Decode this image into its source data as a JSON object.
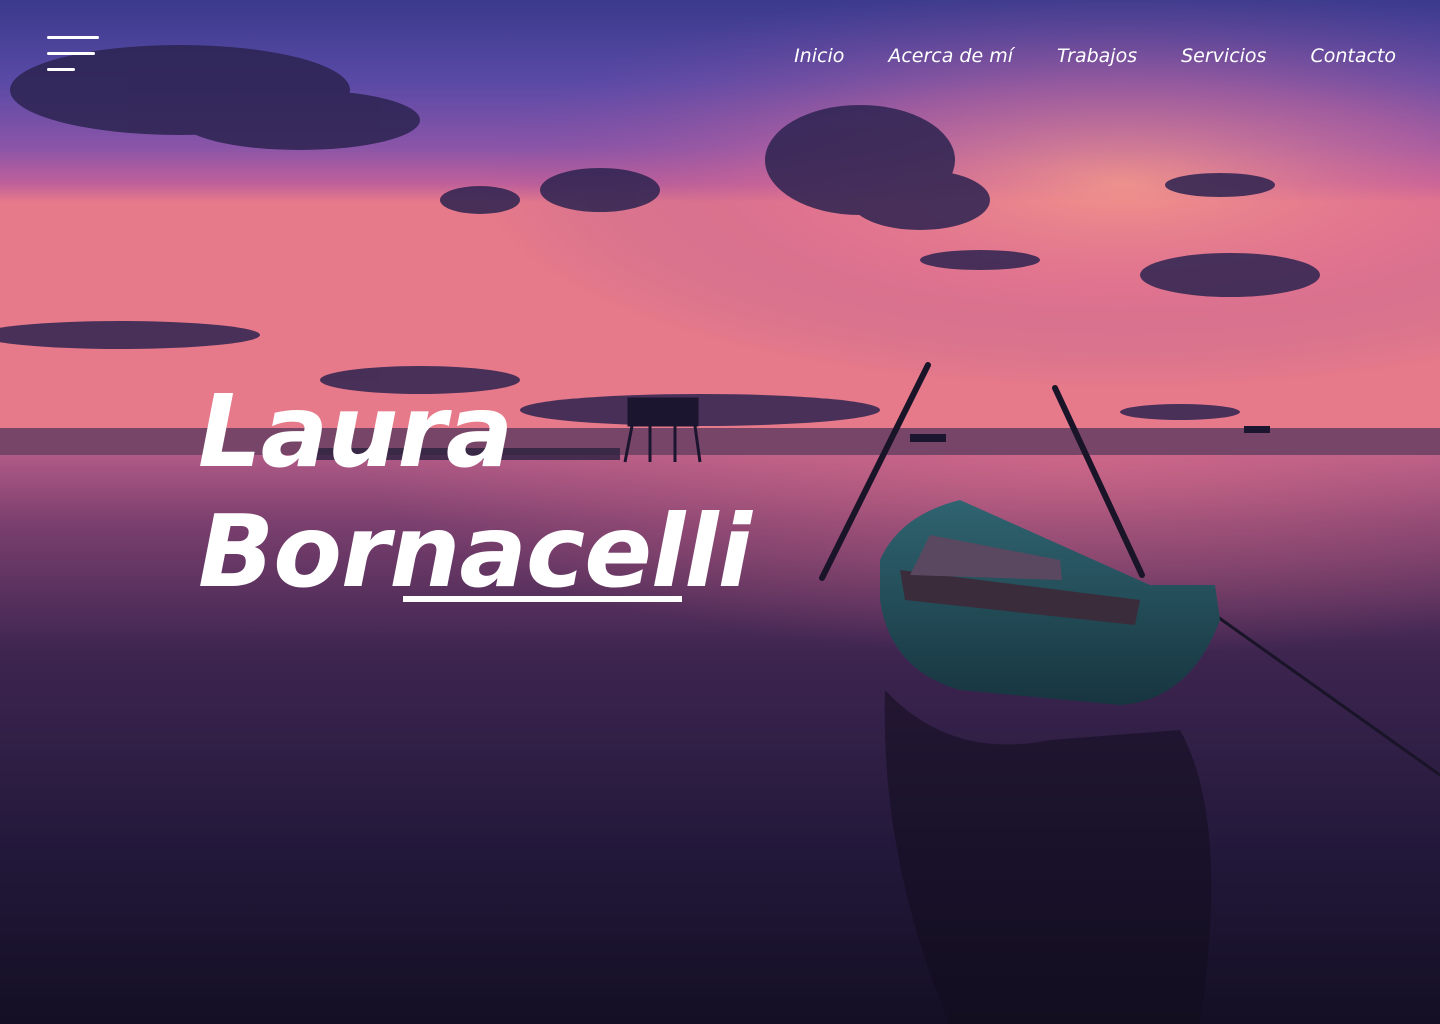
{
  "header": {
    "menu_icon": "hamburger-menu-icon",
    "nav": [
      {
        "label": "Inicio"
      },
      {
        "label": "Acerca de mí"
      },
      {
        "label": "Trabajos"
      },
      {
        "label": "Servicios"
      },
      {
        "label": "Contacto"
      }
    ]
  },
  "hero": {
    "first_name": "Laura",
    "last_name": "Bornacelli",
    "text_color": "#ffffff",
    "background_image": "sunset-lake-boat-scene"
  }
}
